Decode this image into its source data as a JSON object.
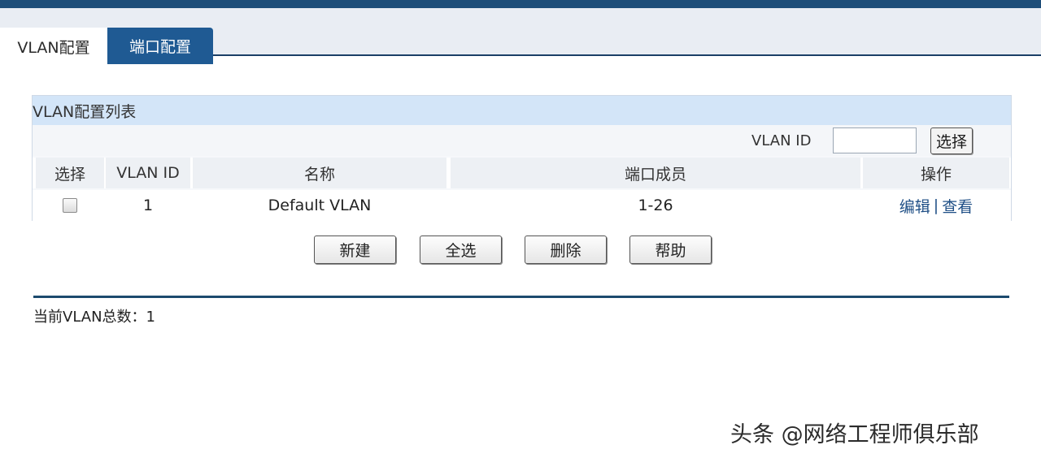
{
  "tabs": [
    {
      "label": "VLAN配置",
      "active": true
    },
    {
      "label": "端口配置",
      "active": false
    }
  ],
  "panel": {
    "title": "VLAN配置列表",
    "filter": {
      "label": "VLAN ID",
      "value": "",
      "button": "选择"
    },
    "columns": [
      "选择",
      "VLAN ID",
      "名称",
      "端口成员",
      "操作"
    ],
    "rows": [
      {
        "vlan_id": "1",
        "name": "Default VLAN",
        "ports": "1-26",
        "checked": false,
        "edit": "编辑",
        "separator": "|",
        "view": "查看"
      }
    ]
  },
  "buttons": {
    "new": "新建",
    "select_all": "全选",
    "delete": "删除",
    "help": "帮助"
  },
  "summary": {
    "total_label": "当前VLAN总数：",
    "total_value": "1"
  },
  "watermark": "头条 @网络工程师俱乐部",
  "colors": {
    "top_bar": "#1e4e79",
    "tab_active_bg": "#ffffff",
    "tab_inactive_bg": "#1f5a93",
    "panel_header_bg": "#d3e5f8",
    "link": "#1f4f86",
    "divider": "#1c4a6e"
  }
}
